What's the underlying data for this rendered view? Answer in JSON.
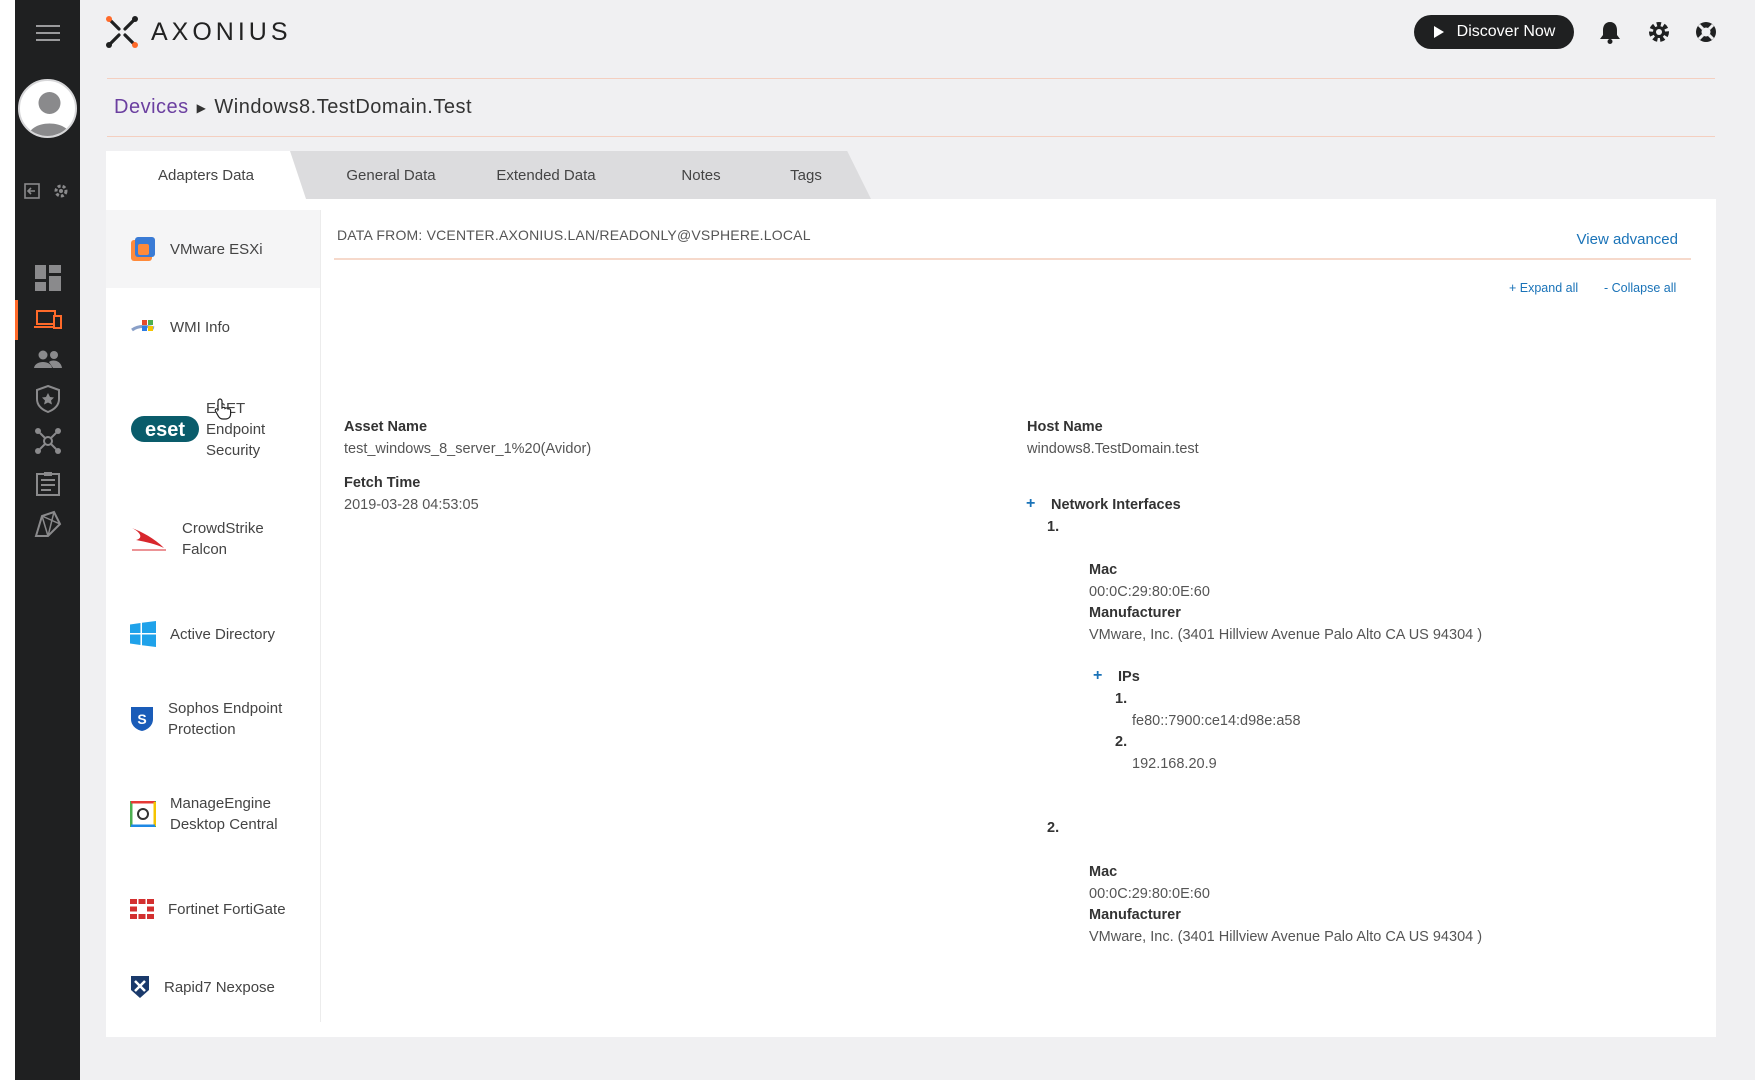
{
  "brand": {
    "name": "AXONIUS"
  },
  "header": {
    "discover_label": "Discover Now"
  },
  "breadcrumb": {
    "root": "Devices",
    "current": "Windows8.TestDomain.Test"
  },
  "tabs": [
    {
      "label": "Adapters Data",
      "active": true
    },
    {
      "label": "General Data"
    },
    {
      "label": "Extended Data"
    },
    {
      "label": "Notes"
    },
    {
      "label": "Tags"
    }
  ],
  "adapters": [
    {
      "label": "VMware ESXi",
      "icon": "vmware-icon",
      "active": true
    },
    {
      "label": "WMI Info",
      "icon": "wmi-icon"
    },
    {
      "label": "ESET Endpoint Security",
      "icon": "eset-logo"
    },
    {
      "label": "CrowdStrike Falcon",
      "icon": "crowdstrike-icon"
    },
    {
      "label": "Active Directory",
      "icon": "windows-icon"
    },
    {
      "label": "Sophos Endpoint Protection",
      "icon": "sophos-icon"
    },
    {
      "label": "ManageEngine Desktop Central",
      "icon": "manageengine-icon"
    },
    {
      "label": "Fortinet FortiGate",
      "icon": "fortinet-icon"
    },
    {
      "label": "Rapid7 Nexpose",
      "icon": "rapid7-icon"
    }
  ],
  "eset_logo_text": "eset",
  "adapter_data": {
    "data_from": "DATA FROM: VCENTER.AXONIUS.LAN/READONLY@VSPHERE.LOCAL",
    "view_advanced": "View advanced",
    "expand_all": "+ Expand all",
    "collapse_all": "- Collapse all",
    "asset_name_label": "Asset Name",
    "asset_name": "test_windows_8_server_1%20(Avidor)",
    "fetch_time_label": "Fetch Time",
    "fetch_time": "2019-03-28 04:53:05",
    "host_name_label": "Host Name",
    "host_name": "windows8.TestDomain.test",
    "network_interfaces_label": "Network Interfaces",
    "plus": "+",
    "interfaces": [
      {
        "index": "1.",
        "mac_label": "Mac",
        "mac": "00:0C:29:80:0E:60",
        "manufacturer_label": "Manufacturer",
        "manufacturer": "VMware, Inc. (3401 Hillview Avenue Palo Alto CA US 94304 )",
        "ips_label": "IPs",
        "ips": [
          {
            "index": "1.",
            "value": "fe80::7900:ce14:d98e:a58"
          },
          {
            "index": "2.",
            "value": "192.168.20.9"
          }
        ]
      },
      {
        "index": "2.",
        "mac_label": "Mac",
        "mac": "00:0C:29:80:0E:60",
        "manufacturer_label": "Manufacturer",
        "manufacturer": "VMware, Inc. (3401 Hillview Avenue Palo Alto CA US 94304 )"
      }
    ]
  },
  "colors": {
    "accent": "#ff6a2a",
    "link": "#1a73b8",
    "breadcrumb_link": "#6b3fa0",
    "rail_bg": "#1f2021"
  }
}
